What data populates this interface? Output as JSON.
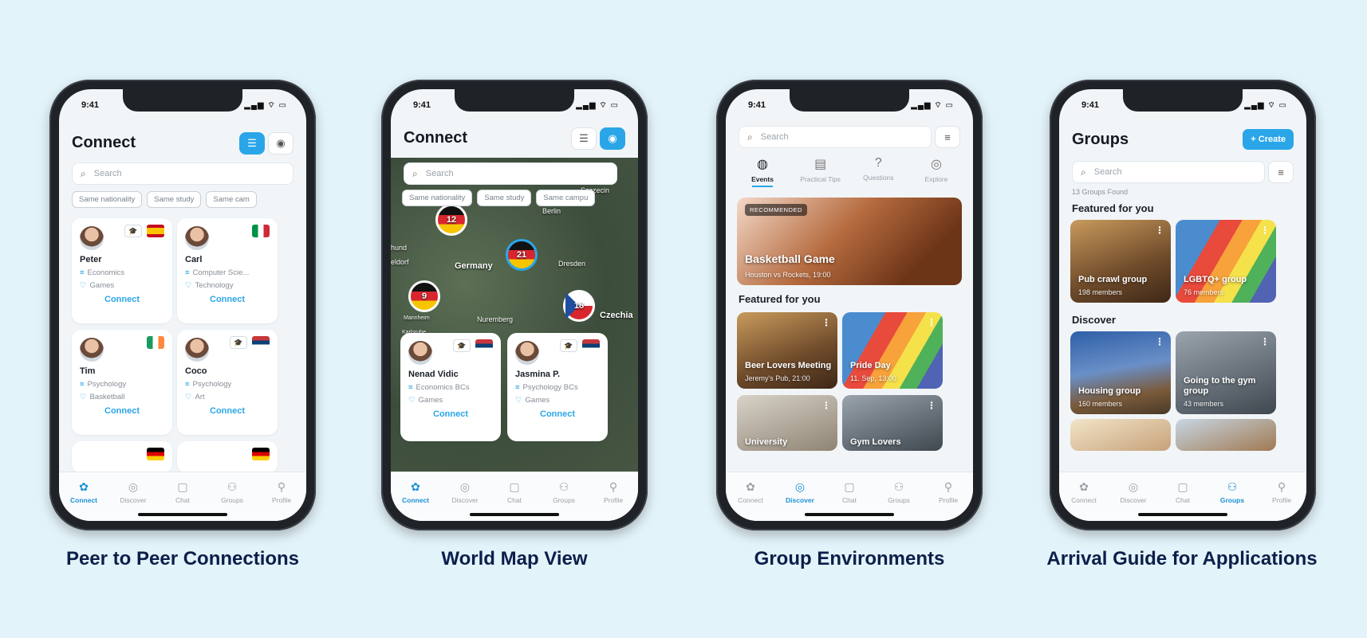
{
  "status_time": "9:41",
  "status_icons": "▂▄▆ ⌔ ▭",
  "tabs": [
    {
      "label": "Connect",
      "icon": "connect-icon"
    },
    {
      "label": "Discover",
      "icon": "compass-icon"
    },
    {
      "label": "Chat",
      "icon": "chat-icon"
    },
    {
      "label": "Groups",
      "icon": "groups-icon"
    },
    {
      "label": "Profile",
      "icon": "profile-icon"
    }
  ],
  "captions": [
    "Peer to Peer Connections",
    "World Map View",
    "Group Environments",
    "Arrival Guide for Applications"
  ],
  "phone1": {
    "title": "Connect",
    "search_placeholder": "Search",
    "chips": [
      "Same nationality",
      "Same study",
      "Same cam"
    ],
    "cards": [
      {
        "name": "Peter",
        "study": "Economics",
        "interest": "Games",
        "action": "Connect",
        "flag": "ES"
      },
      {
        "name": "Carl",
        "study": "Computer Scie...",
        "interest": "Technology",
        "action": "Connect",
        "flag": "IT"
      },
      {
        "name": "Tim",
        "study": "Psychology",
        "interest": "Basketball",
        "action": "Connect",
        "flag": "IE"
      },
      {
        "name": "Coco",
        "study": "Psychology",
        "interest": "Art",
        "action": "Connect",
        "flag": "RS"
      }
    ]
  },
  "phone2": {
    "title": "Connect",
    "search_placeholder": "Search",
    "chips": [
      "Same nationality",
      "Same study",
      "Same campu"
    ],
    "map_labels": [
      "Berlin",
      "Germany",
      "Dresden",
      "Nuremberg",
      "Mannheim",
      "Karlsruhe",
      "Czechia",
      "Szczecin",
      "hund",
      "eldorf"
    ],
    "clusters": [
      "12",
      "21",
      "9",
      "18"
    ],
    "cards": [
      {
        "name": "Nenad Vidic",
        "study": "Economics BCs",
        "interest": "Games",
        "action": "Connect"
      },
      {
        "name": "Jasmina P.",
        "study": "Psychology BCs",
        "interest": "Games",
        "action": "Connect"
      }
    ]
  },
  "phone3": {
    "search_placeholder": "Search",
    "segments": [
      "Events",
      "Practical Tips",
      "Questions",
      "Explore"
    ],
    "hero": {
      "badge": "RECOMMENDED",
      "title": "Basketball Game",
      "subtitle": "Houston vs Rockets, 19:00"
    },
    "featured_title": "Featured for you",
    "featured": [
      {
        "title": "Beer Lovers Meeting",
        "subtitle": "Jeremy's Pub, 21:00"
      },
      {
        "title": "Pride Day",
        "subtitle": "11. Sep, 13:00"
      },
      {
        "title": "University",
        "subtitle": ""
      },
      {
        "title": "Gym Lovers",
        "subtitle": ""
      }
    ]
  },
  "phone4": {
    "title": "Groups",
    "create_label": "+ Create",
    "search_placeholder": "Search",
    "found": "13 Groups Found",
    "featured_title": "Featured for you",
    "featured": [
      {
        "title": "Pub crawl group",
        "members": "198 members"
      },
      {
        "title": "LGBTQ+ group",
        "members": "76 members"
      }
    ],
    "discover_title": "Discover",
    "discover": [
      {
        "title": "Housing group",
        "members": "160 members"
      },
      {
        "title": "Going to the gym group",
        "members": "43 members"
      }
    ]
  },
  "colors": {
    "accent": "#2aa6e8",
    "background": "#e3f3fa",
    "caption": "#0c1f4a"
  }
}
